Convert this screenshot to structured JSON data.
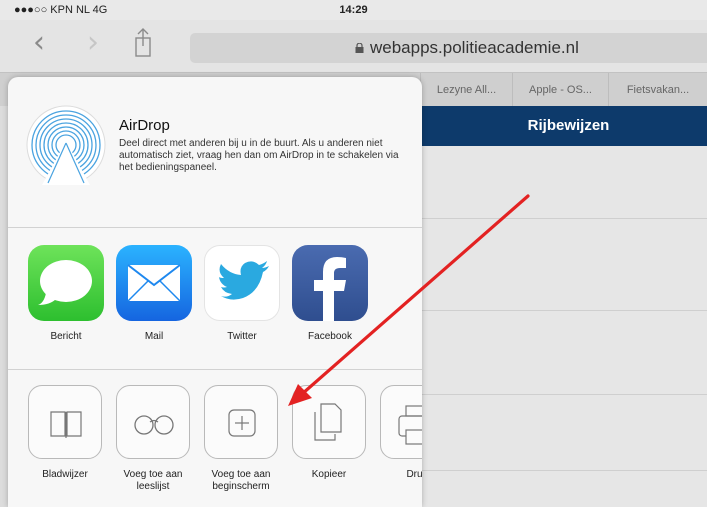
{
  "status": {
    "carrier": "●●●○○ KPN NL  4G",
    "time": "14:29"
  },
  "toolbar": {
    "url": "webapps.politieacademie.nl"
  },
  "bookmarks": [
    "Lezyne All...",
    "Apple - OS...",
    "Fietsvakan..."
  ],
  "page": {
    "title": "Rijbewijzen"
  },
  "airdrop": {
    "title": "AirDrop",
    "description": "Deel direct met anderen bij u in de buurt. Als u anderen niet automatisch ziet, vraag hen dan om AirDrop in te schakelen via het bedieningspaneel."
  },
  "apps": [
    {
      "label": "Bericht",
      "icon": "messages-icon"
    },
    {
      "label": "Mail",
      "icon": "mail-icon"
    },
    {
      "label": "Twitter",
      "icon": "twitter-icon"
    },
    {
      "label": "Facebook",
      "icon": "facebook-icon"
    }
  ],
  "actions": [
    {
      "label": "Bladwijzer",
      "icon": "bookmark-icon"
    },
    {
      "label": "Voeg toe aan leeslijst",
      "icon": "reading-list-icon"
    },
    {
      "label": "Voeg toe aan beginscherm",
      "icon": "add-home-icon"
    },
    {
      "label": "Kopieer",
      "icon": "copy-icon"
    },
    {
      "label": "Druk",
      "icon": "print-icon"
    }
  ],
  "colors": {
    "page_header": "#0d3a6b",
    "annotation_arrow": "#e32222",
    "messages_green": "#4cd964",
    "mail_blue": "#1e88ef",
    "facebook_blue": "#3b5998",
    "twitter_blue": "#2aa9e0"
  }
}
